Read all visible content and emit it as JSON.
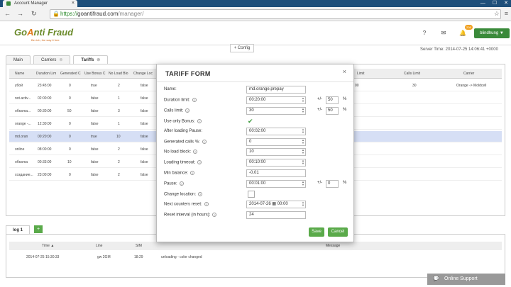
{
  "browser": {
    "tab_title": "Account Manager",
    "close_glyph": "×",
    "win_controls": [
      "—",
      "☐",
      "✕"
    ],
    "url_secure": "https://",
    "url_domain": "goantifraud.com",
    "url_path": "/manager/"
  },
  "header": {
    "logo_text_a": "Go",
    "logo_mark": "A",
    "logo_text_b": "nti Fraud",
    "logo_tagline": "Be rich, the way it free",
    "help_glyph": "?",
    "badge": "208",
    "user": "blindhung ▼"
  },
  "config_button": "+ Config",
  "server_time": "Server Time: 2014-07-25 14:06:41 +0000",
  "tabs": [
    {
      "label": "Main",
      "active": false
    },
    {
      "label": "Carriers",
      "active": false
    },
    {
      "label": "Tariffs",
      "active": true
    }
  ],
  "grid": {
    "columns": [
      "Name",
      "Duration Lim",
      "Generated C",
      "Use Bonus C",
      "No Load Blo",
      "Change Loc",
      "Limit",
      "Calls Limit",
      "Carrier"
    ],
    "rows": [
      {
        "name": "убой",
        "duration": "23:45:00",
        "gen": "0",
        "bonus": "true",
        "noload": "2",
        "change": "false"
      },
      {
        "name": "not.activ...",
        "duration": "02:00:00",
        "gen": "0",
        "bonus": "false",
        "noload": "1",
        "change": "false"
      },
      {
        "name": "обкатка...",
        "duration": "00:30:00",
        "gen": "50",
        "bonus": "false",
        "noload": "3",
        "change": "false"
      },
      {
        "name": "orange -...",
        "duration": "12:30:00",
        "gen": "0",
        "bonus": "false",
        "noload": "1",
        "change": "false"
      },
      {
        "name": "md.oran",
        "duration": "00:20:00",
        "gen": "0",
        "bonus": "true",
        "noload": "10",
        "change": "false"
      },
      {
        "name": "online",
        "duration": "08:00:00",
        "gen": "0",
        "bonus": "false",
        "noload": "2",
        "change": "false"
      },
      {
        "name": "обкатка",
        "duration": "00:33:00",
        "gen": "10",
        "bonus": "false",
        "noload": "2",
        "change": "false"
      },
      {
        "name": "создание...",
        "duration": "23:00:00",
        "gen": "0",
        "bonus": "false",
        "noload": "2",
        "change": "false"
      }
    ],
    "first_row_extra": {
      "limit": "00",
      "calls_limit": "30",
      "carrier": "Orange -> Moldcell"
    }
  },
  "modal": {
    "title": "TARIFF FORM",
    "close": "×",
    "fields": {
      "name": {
        "label": "Name:",
        "value": "md.orange.prepay"
      },
      "duration": {
        "label": "Duration limit:",
        "value": "00:20:00",
        "pct": "50"
      },
      "calls": {
        "label": "Calls limit:",
        "value": "30",
        "pct": "50"
      },
      "bonus": {
        "label": "Use only Bonus:"
      },
      "after_loading": {
        "label": "After loading Pause:",
        "value": "00:02:00"
      },
      "generated": {
        "label": "Generated calls %:",
        "value": "0"
      },
      "noload": {
        "label": "No load block:",
        "value": "10"
      },
      "loading_timeout": {
        "label": "Loading timeout:",
        "value": "00:10:00"
      },
      "min_balance": {
        "label": "Min balance:",
        "value": "-0.01"
      },
      "pause": {
        "label": "Pause:",
        "value": "00:01:00",
        "pct": "0"
      },
      "change_location": {
        "label": "Change location:"
      },
      "next_reset": {
        "label": "Next counters reset:",
        "date": "2014-07-26",
        "time": "00:00"
      },
      "reset_interval": {
        "label": "Reset interval (in hours):",
        "value": "24"
      }
    },
    "pm_label": "+/-",
    "pct_label": "%",
    "help_glyph": "?",
    "check_glyph": "✔",
    "save": "Save",
    "cancel": "Cancel"
  },
  "log": {
    "tab": "log 1",
    "add": "+",
    "columns": [
      "Time ▲",
      "Line",
      "SIM",
      "Message"
    ],
    "row": {
      "time": "2014-07-25 15:30:33",
      "line": "gw 2GM",
      "sim": "18:29",
      "message": "unloading - color changed"
    }
  },
  "support": "Online Support"
}
